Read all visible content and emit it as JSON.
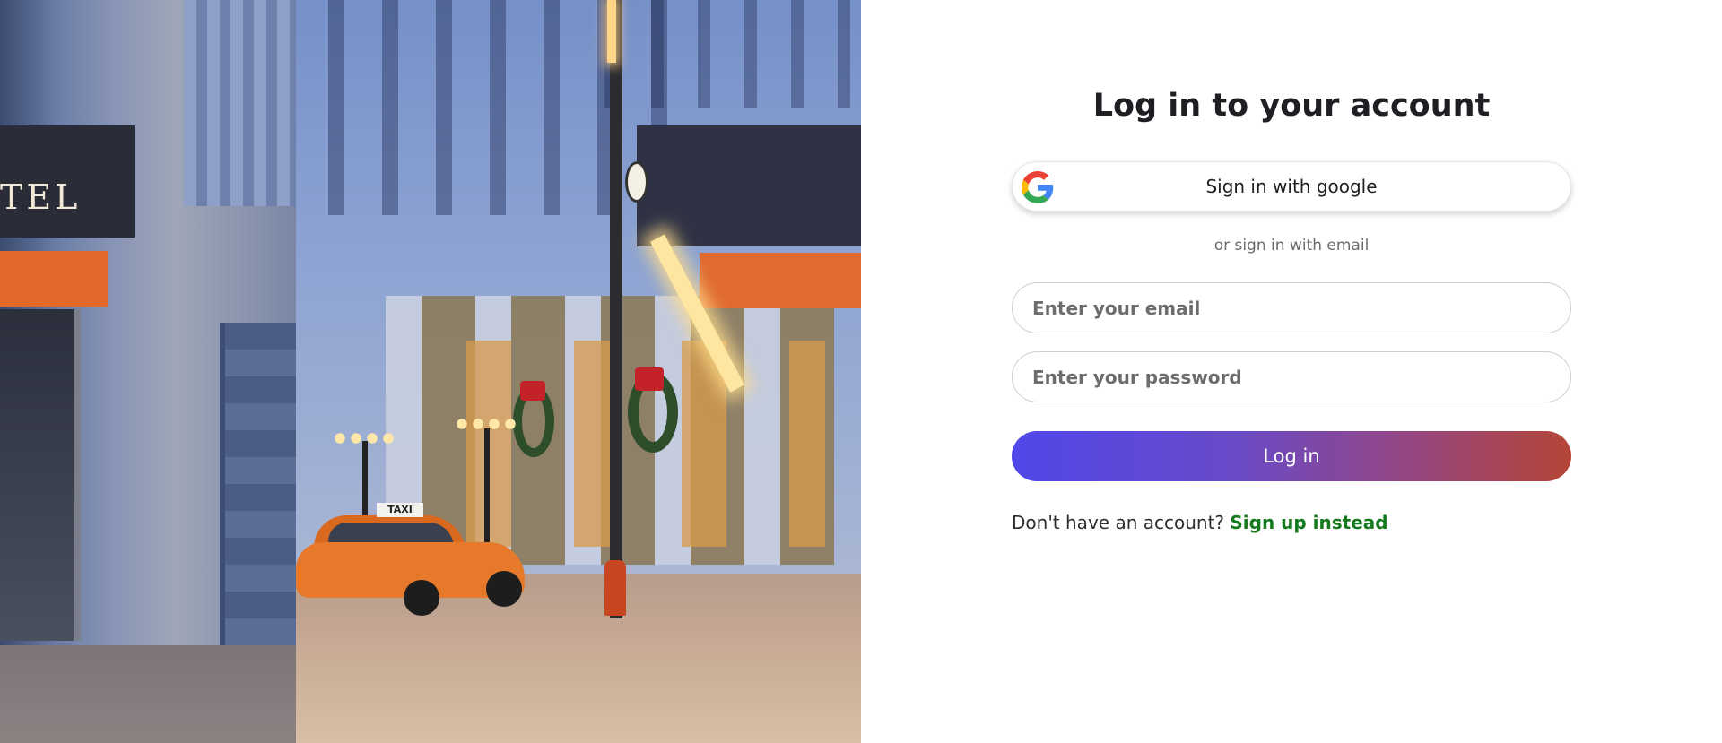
{
  "hero": {
    "sign_text": "TEL",
    "taxi_sign": "TAXI"
  },
  "login": {
    "title": "Log in to your account",
    "google_button": "Sign in with google",
    "divider": "or sign in with email",
    "email_placeholder": "Enter your email",
    "password_placeholder": "Enter your password",
    "submit": "Log in",
    "no_account": "Don't have an account?",
    "signup_link": "Sign up instead"
  },
  "colors": {
    "title": "#1d1f23",
    "link": "#157a1d",
    "button_gradient_start": "#4f48e8",
    "button_gradient_end": "#b54536"
  },
  "icons": {
    "google": "google-logo-icon"
  }
}
